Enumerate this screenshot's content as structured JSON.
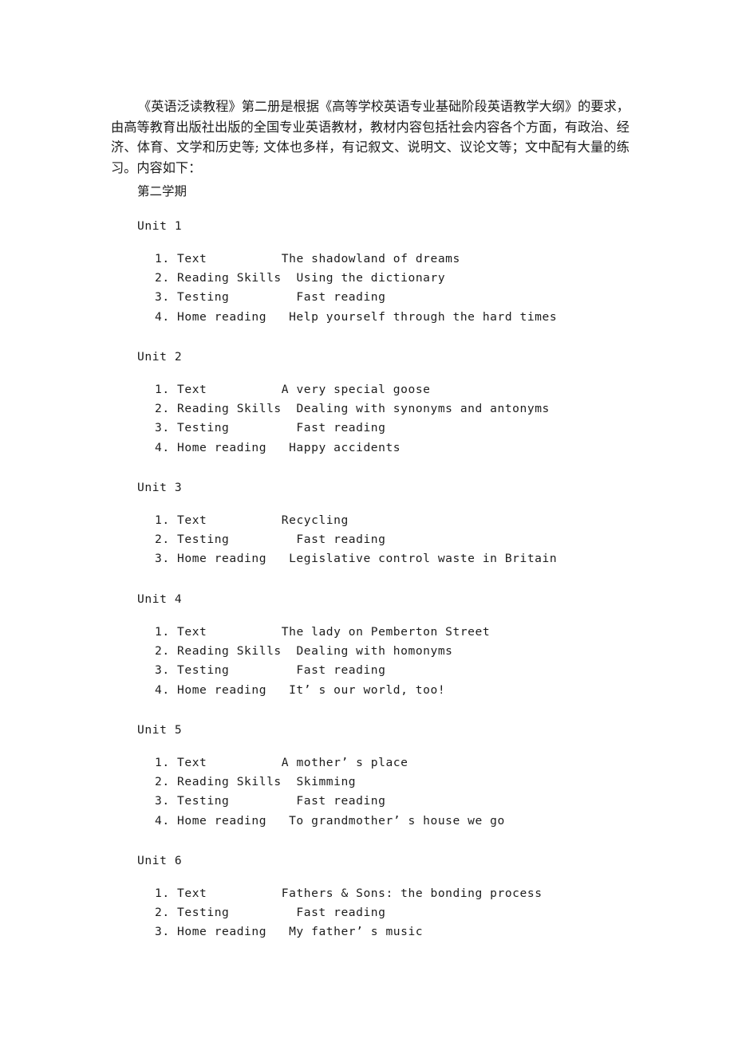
{
  "document": {
    "intro_paragraph": "《英语泛读教程》第二册是根据《高等学校英语专业基础阶段英语教学大纲》的要求，由高等教育出版社出版的全国专业英语教材，教材内容包括社会内容各个方面，有政治、经济、体育、文学和历史等; 文体也多样，有记叙文、说明文、议论文等；文中配有大量的练习。内容如下：",
    "term_heading": "第二学期",
    "units": [
      {
        "title": "Unit 1",
        "items": [
          {
            "number": "1.",
            "label": "Text",
            "pad": "          ",
            "description": "The shadowland of dreams"
          },
          {
            "number": "2.",
            "label": "Reading Skills",
            "pad": "  ",
            "description": "Using the dictionary"
          },
          {
            "number": "3.",
            "label": "Testing",
            "pad": "         ",
            "description": "Fast reading"
          },
          {
            "number": "4.",
            "label": "Home reading",
            "pad": "   ",
            "description": "Help yourself through the hard times"
          }
        ]
      },
      {
        "title": "Unit 2",
        "items": [
          {
            "number": "1.",
            "label": "Text",
            "pad": "          ",
            "description": "A very special goose"
          },
          {
            "number": "2.",
            "label": "Reading Skills",
            "pad": "  ",
            "description": "Dealing with synonyms and antonyms"
          },
          {
            "number": "3.",
            "label": "Testing",
            "pad": "         ",
            "description": "Fast reading"
          },
          {
            "number": "4.",
            "label": "Home reading",
            "pad": "   ",
            "description": "Happy accidents"
          }
        ]
      },
      {
        "title": "Unit 3",
        "items": [
          {
            "number": "1.",
            "label": "Text",
            "pad": "          ",
            "description": "Recycling"
          },
          {
            "number": "2.",
            "label": "Testing",
            "pad": "         ",
            "description": "Fast reading"
          },
          {
            "number": "3.",
            "label": "Home reading",
            "pad": "   ",
            "description": "Legislative control waste in Britain"
          }
        ]
      },
      {
        "title": "Unit 4",
        "items": [
          {
            "number": "1.",
            "label": "Text",
            "pad": "          ",
            "description": "The lady on Pemberton Street"
          },
          {
            "number": "2.",
            "label": "Reading Skills",
            "pad": "  ",
            "description": "Dealing with homonyms"
          },
          {
            "number": "3.",
            "label": "Testing",
            "pad": "         ",
            "description": "Fast reading"
          },
          {
            "number": "4.",
            "label": "Home reading",
            "pad": "   ",
            "description": "It’ s our world, too!"
          }
        ]
      },
      {
        "title": "Unit 5",
        "items": [
          {
            "number": "1.",
            "label": "Text",
            "pad": "          ",
            "description": "A mother’ s place"
          },
          {
            "number": "2.",
            "label": "Reading Skills",
            "pad": "  ",
            "description": "Skimming"
          },
          {
            "number": "3.",
            "label": "Testing",
            "pad": "         ",
            "description": "Fast reading"
          },
          {
            "number": "4.",
            "label": "Home reading",
            "pad": "   ",
            "description": "To grandmother’ s house we go"
          }
        ]
      },
      {
        "title": "Unit 6",
        "items": [
          {
            "number": "1.",
            "label": "Text",
            "pad": "          ",
            "description": "Fathers & Sons: the bonding process"
          },
          {
            "number": "2.",
            "label": "Testing",
            "pad": "         ",
            "description": "Fast reading"
          },
          {
            "number": "3.",
            "label": "Home reading",
            "pad": "   ",
            "description": "My father’ s music"
          }
        ]
      }
    ]
  }
}
